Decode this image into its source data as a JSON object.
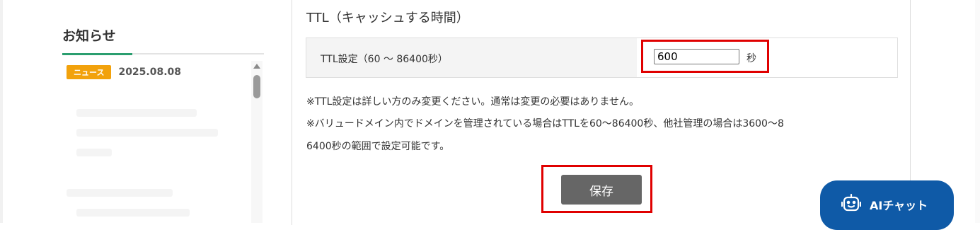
{
  "news": {
    "title": "お知らせ",
    "items": [
      {
        "badge": "ニュース",
        "date": "2025.08.08"
      }
    ]
  },
  "ttl": {
    "heading": "TTL（キャッシュする時間）",
    "label": "TTL設定（60 ～ 86400秒）",
    "value": "600",
    "unit": "秒"
  },
  "notes": [
    "※TTL設定は詳しい方のみ変更ください。通常は変更の必要はありません。",
    "※バリュードメイン内でドメインを管理されている場合はTTLを60～86400秒、他社管理の場合は3600～8",
    "6400秒の範囲で設定可能です。"
  ],
  "save_label": "保存",
  "ai_chat_label": "AIチャット",
  "colors": {
    "accent_green": "#2a9e6f",
    "badge_orange": "#f2a20c",
    "highlight_red": "#e00000",
    "chat_blue": "#0f5aa7",
    "save_gray": "#666666"
  },
  "icons": {
    "scroll_up": "scroll-up-arrow-icon",
    "chat": "chat-robot-icon"
  }
}
